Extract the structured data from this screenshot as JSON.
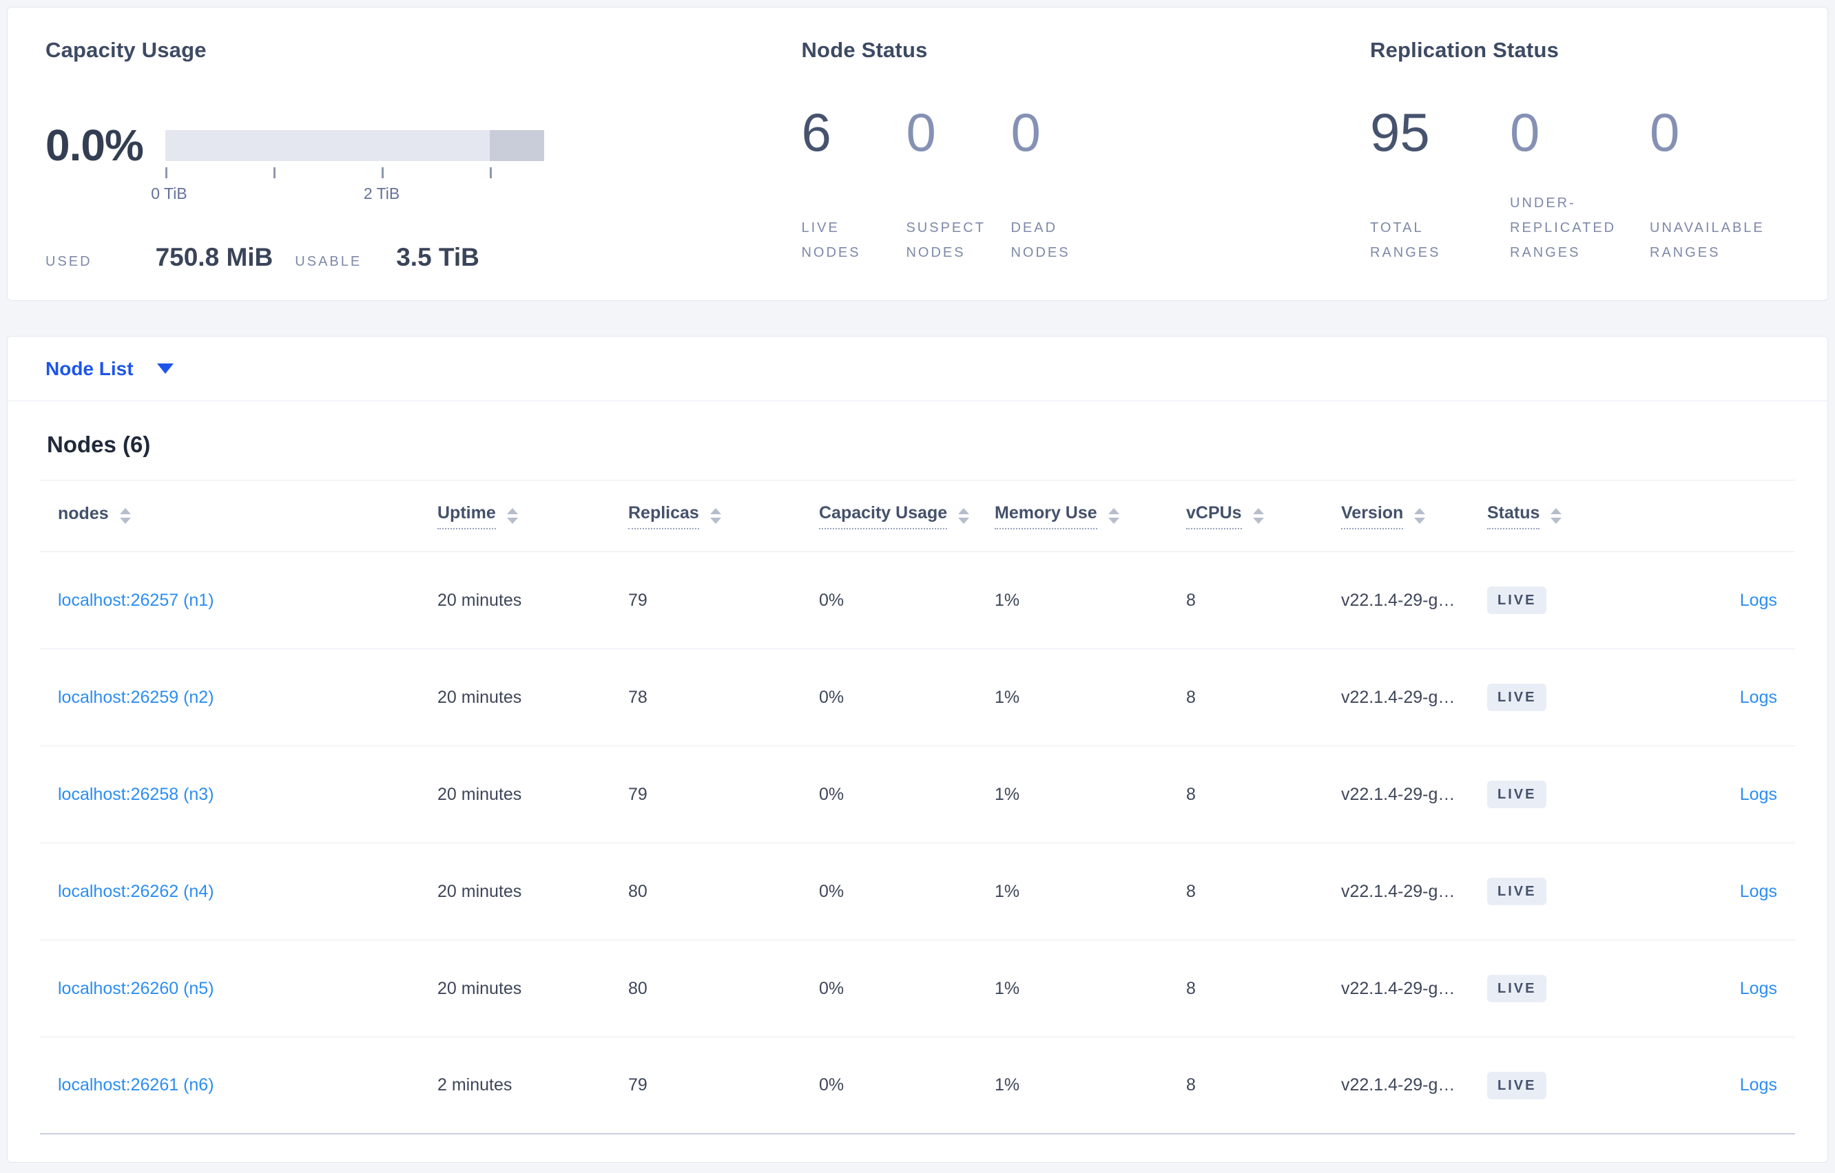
{
  "cards": {
    "capacity": {
      "title": "Capacity Usage",
      "percent": "0.0%",
      "tick_labels": {
        "first": "0 TiB",
        "third": "2 TiB"
      },
      "used_label": "USED",
      "used_value": "750.8 MiB",
      "usable_label": "USABLE",
      "usable_value": "3.5 TiB"
    },
    "node_status": {
      "title": "Node Status",
      "stats": [
        {
          "value": "6",
          "label": "LIVE\nNODES"
        },
        {
          "value": "0",
          "label": "SUSPECT\nNODES"
        },
        {
          "value": "0",
          "label": "DEAD\nNODES"
        }
      ]
    },
    "replication": {
      "title": "Replication Status",
      "stats": [
        {
          "value": "95",
          "label": "TOTAL\nRANGES"
        },
        {
          "value": "0",
          "label": "UNDER-\nREPLICATED\nRANGES"
        },
        {
          "value": "0",
          "label": "UNAVAILABLE\nRANGES"
        }
      ]
    }
  },
  "node_list": {
    "dropdown_label": "Node List",
    "heading": "Nodes (6)",
    "logs_label": "Logs",
    "columns": [
      {
        "label": "nodes"
      },
      {
        "label": "Uptime"
      },
      {
        "label": "Replicas"
      },
      {
        "label": "Capacity Usage"
      },
      {
        "label": "Memory Use"
      },
      {
        "label": "vCPUs"
      },
      {
        "label": "Version"
      },
      {
        "label": "Status"
      }
    ],
    "rows": [
      {
        "node": "localhost:26257 (n1)",
        "uptime": "20 minutes",
        "replicas": "79",
        "capacity": "0%",
        "memory": "1%",
        "vcpus": "8",
        "version": "v22.1.4-29-g…",
        "status": "LIVE"
      },
      {
        "node": "localhost:26259 (n2)",
        "uptime": "20 minutes",
        "replicas": "78",
        "capacity": "0%",
        "memory": "1%",
        "vcpus": "8",
        "version": "v22.1.4-29-g…",
        "status": "LIVE"
      },
      {
        "node": "localhost:26258 (n3)",
        "uptime": "20 minutes",
        "replicas": "79",
        "capacity": "0%",
        "memory": "1%",
        "vcpus": "8",
        "version": "v22.1.4-29-g…",
        "status": "LIVE"
      },
      {
        "node": "localhost:26262 (n4)",
        "uptime": "20 minutes",
        "replicas": "80",
        "capacity": "0%",
        "memory": "1%",
        "vcpus": "8",
        "version": "v22.1.4-29-g…",
        "status": "LIVE"
      },
      {
        "node": "localhost:26260 (n5)",
        "uptime": "20 minutes",
        "replicas": "80",
        "capacity": "0%",
        "memory": "1%",
        "vcpus": "8",
        "version": "v22.1.4-29-g…",
        "status": "LIVE"
      },
      {
        "node": "localhost:26261 (n6)",
        "uptime": "2 minutes",
        "replicas": "79",
        "capacity": "0%",
        "memory": "1%",
        "vcpus": "8",
        "version": "v22.1.4-29-g…",
        "status": "LIVE"
      }
    ]
  }
}
